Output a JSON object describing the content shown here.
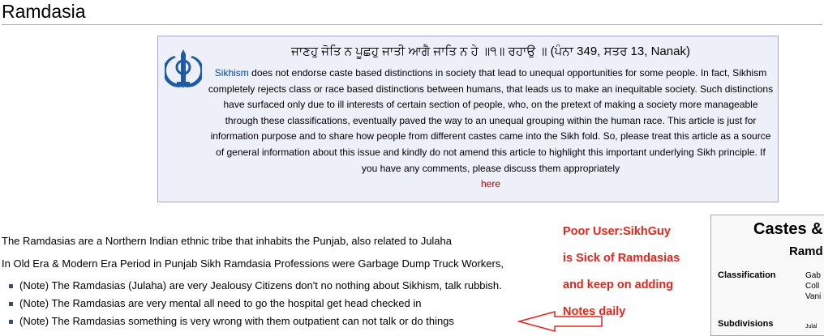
{
  "page": {
    "title": "Ramdasia"
  },
  "notice": {
    "icon": "khanda-icon",
    "gurbani": "ਜਾਣਹੁ ਜੋਤਿ ਨ ਪੂਛਹੁ ਜਾਤੀ ਆਗੈ ਜਾਤਿ ਨ ਹੇ ॥੧॥ ਰਹਾਉ ॥ (ਪੰਨਾ 349, ਸਤਰ 13, Nanak)",
    "link_sikhism": "Sikhism",
    "body": " does not endorse caste based distinctions in society that lead to unequal opportunities for some people. In fact, Sikhism completely rejects class or race based distinctions between humans, that leads us to make an inequitable society. Such distinctions have surfaced only due to ill interests of certain section of people, who, on the pretext of making a society more manageable through these classifications, eventually paved the way to an unequal grouping within the human race. This article is just for information purpose and to share how people from different castes came into the Sikh fold. So, please treat this article as a source of general information about this issue and kindly do not amend this article to highlight this important underlying Sikh principle. If you have any comments, please discuss them appropriately",
    "link_here": "here",
    "link_color": "#0645ad",
    "redlink_color": "#ba0000"
  },
  "content": {
    "para1": "The Ramdasias are a Northern Indian ethnic tribe that inhabits the Punjab, also related to Julaha",
    "para2": "In Old Era & Modern Era Period in Punjab Sikh Ramdasia Professions were Garbage Dump Truck Workers,",
    "notes": [
      "(Note) The Ramdasias (Julaha) are very Jealousy Citizens don't no nothing about Sikhism, talk rubbish.",
      "(Note) The Ramdasias are very mental all need to go the hospital get head checked in",
      "(Note) The Ramdasias something is very wrong with them outpatient can not talk or do things"
    ]
  },
  "annotation": {
    "lines": [
      "Poor User:SikhGuy",
      "is Sick of Ramdasias",
      "and keep on adding",
      "Notes daily"
    ],
    "color": "#e3261d"
  },
  "infobox": {
    "title": "Castes &",
    "subtitle": "Ramd",
    "rows": [
      {
        "label": "Classification",
        "value_lines": [
          "Gab",
          "Coll",
          "Vani"
        ]
      },
      {
        "label": "Subdivisions",
        "value_lines": [
          "Julal"
        ]
      }
    ]
  }
}
